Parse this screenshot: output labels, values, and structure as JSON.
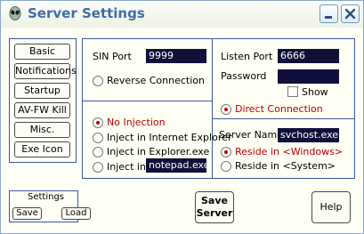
{
  "window": {
    "title": "Server Settings",
    "icons": {
      "app": "alien-icon",
      "minimize": "minimize-icon",
      "close": "close-icon"
    }
  },
  "sidebar": {
    "items": [
      {
        "label": "Basic"
      },
      {
        "label": "Notifications"
      },
      {
        "label": "Startup"
      },
      {
        "label": "AV-FW Kill"
      },
      {
        "label": "Misc."
      },
      {
        "label": "Exe Icon"
      }
    ]
  },
  "settings_box": {
    "title": "Settings",
    "save_label": "Save",
    "load_label": "Load"
  },
  "connection": {
    "sin_port_label": "SIN Port",
    "sin_port_value": "9999",
    "reverse_connection_label": "Reverse Connection",
    "listen_port_label": "Listen Port",
    "listen_port_value": "6666",
    "password_label": "Password",
    "password_value": "",
    "show_label": "Show",
    "direct_connection_label": "Direct Connection"
  },
  "injection": {
    "options": [
      {
        "label": "No Injection",
        "checked": true
      },
      {
        "label": "Inject in Internet Explorer",
        "checked": false
      },
      {
        "label": "Inject in Explorer.exe",
        "checked": false
      },
      {
        "label": "Inject in",
        "checked": false
      }
    ],
    "custom_process_value": "notepad.exe"
  },
  "server": {
    "name_label": "Server Name",
    "name_value": "svchost.exe",
    "reside_windows_label": "Reside in <Windows>",
    "reside_system_label": "Reside in <System>"
  },
  "actions": {
    "save_server_line1": "Save",
    "save_server_line2": "Server",
    "help_label": "Help"
  },
  "colors": {
    "title_text": "#3f6da8",
    "field_bg": "#10103a",
    "selected_text": "#b40000",
    "panel_border": "#3b5998"
  }
}
